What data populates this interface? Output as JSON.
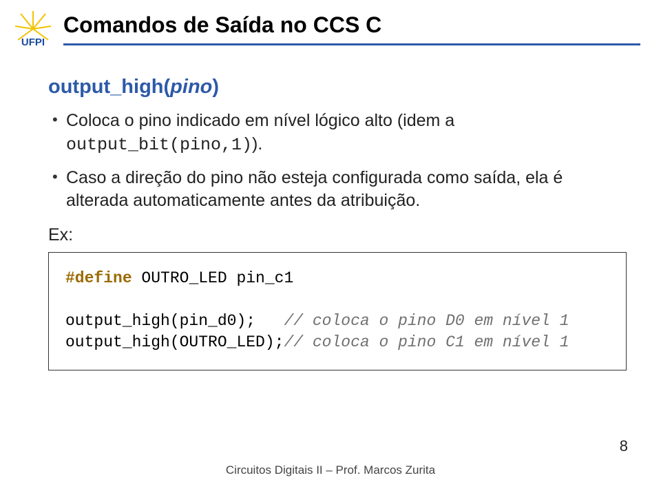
{
  "logo": {
    "label_text": "UFPI",
    "ray_color": "#f2c200",
    "text_color": "#1a4aa0"
  },
  "title": "Comandos de Saída no CCS C",
  "section_title_parts": {
    "func": "output_high(",
    "arg": "pino",
    "close": ")"
  },
  "bullets": [
    {
      "pre": "Coloca o pino indicado em nível lógico alto (idem a ",
      "mono": "output_bit(pino,1)",
      "post": ")."
    },
    {
      "pre": "Caso a direção do pino não esteja configurada como saída, ela é alterada automaticamente antes da atribuição.",
      "mono": "",
      "post": ""
    }
  ],
  "ex_label": "Ex:",
  "code": {
    "l1_kw": "#define",
    "l1_rest": " OUTRO_LED pin_c1",
    "l2_a": "output_high(pin_d0);   ",
    "l2_c": "// coloca o pino D0 em nível 1",
    "l3_a": "output_high(OUTRO_LED);",
    "l3_c": "// coloca o pino C1 em nível 1"
  },
  "page_number": "8",
  "footer": "Circuitos Digitais II – Prof. Marcos Zurita"
}
